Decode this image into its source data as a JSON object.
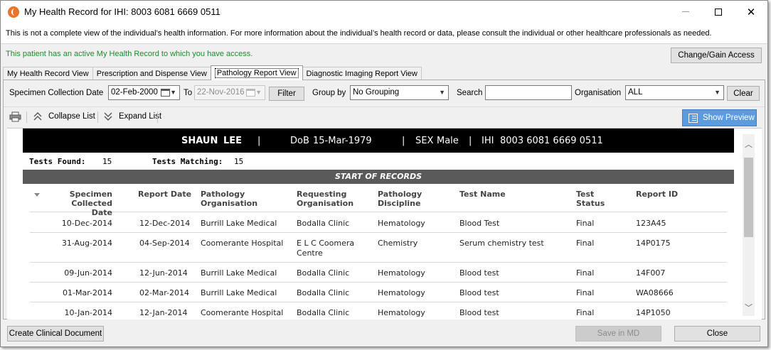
{
  "window": {
    "title": "My Health Record for IHI: 8003 6081 6669 0511",
    "minimize": "—",
    "maximize": "",
    "close": "✕"
  },
  "notice": "This is not a complete view of the individual’s health information. For more information about the individual’s health record or data, please consult the individual or other healthcare professionals as needed.",
  "access": {
    "text": "This patient has an active My Health Record to which you have access.",
    "button": "Change/Gain Access",
    "text_color": "#1e8a2e"
  },
  "tabs": [
    {
      "label": "My Health Record View",
      "active": false
    },
    {
      "label": "Prescription and Dispense View",
      "active": false
    },
    {
      "label": "Pathology Report View",
      "active": true
    },
    {
      "label": "Diagnostic Imaging Report View",
      "active": false
    }
  ],
  "filters": {
    "specimen_label": "Specimen Collection Date",
    "from_date": "02-Feb-2000",
    "to_label": "To",
    "to_date": "22-Nov-2016",
    "filter_button": "Filter",
    "group_label": "Group by",
    "group_value": "No Grouping",
    "search_label": "Search",
    "search_value": "",
    "organisation_label": "Organisation",
    "organisation_value": "ALL",
    "clear_button": "Clear"
  },
  "toolbar": {
    "print_icon": "printer-icon",
    "collapse": "Collapse List",
    "expand": "Expand List",
    "show_preview": "Show Preview",
    "accent": "#5b9ce0"
  },
  "patient": {
    "first_name": "SHAUN",
    "last_name": "LEE",
    "sep": "|",
    "dob_label": "DoB",
    "dob": "15-Mar-1979",
    "sex_label": "SEX",
    "sex": "Male",
    "ihi_label": "IHI",
    "ihi": "8003 6081 6669 0511"
  },
  "counts": {
    "found_label": "Tests Found:",
    "found": "15",
    "matching_label": "Tests Matching:",
    "matching": "15"
  },
  "start_label": "START OF RECORDS",
  "columns": {
    "collected_1": "Specimen",
    "collected_2": "Collected Date",
    "report_date": "Report Date",
    "path_org_1": "Pathology",
    "path_org_2": "Organisation",
    "req_org_1": "Requesting",
    "req_org_2": "Organisation",
    "discipline_1": "Pathology",
    "discipline_2": "Discipline",
    "test_name": "Test Name",
    "status_1": "Test",
    "status_2": "Status",
    "report_id": "Report ID"
  },
  "rows": [
    {
      "collected": "10-Dec-2014",
      "report_date": "12-Dec-2014",
      "path_org": "Burrill Lake Medical",
      "req_org_1": "Bodalla Clinic",
      "req_org_2": "",
      "discipline": "Hematology",
      "test": "Blood Test",
      "status": "Final",
      "report_id": "123A45"
    },
    {
      "collected": "31-Aug-2014",
      "report_date": "04-Sep-2014",
      "path_org": "Coomerante Hospital",
      "req_org_1": "E L C Coomera",
      "req_org_2": "Centre",
      "discipline": "Chemistry",
      "test": "Serum chemistry test",
      "status": "Final",
      "report_id": "14P0175"
    },
    {
      "collected": "09-Jun-2014",
      "report_date": "12-Jun-2014",
      "path_org": "Burrill Lake Medical",
      "req_org_1": "Bodalla Clinic",
      "req_org_2": "",
      "discipline": "Hematology",
      "test": "Blood test",
      "status": "Final",
      "report_id": "14F007"
    },
    {
      "collected": "01-Mar-2014",
      "report_date": "02-Mar-2014",
      "path_org": "Burrill Lake Medical",
      "req_org_1": "Bodalla Clinic",
      "req_org_2": "",
      "discipline": "Hematology",
      "test": "Blood test",
      "status": "Final",
      "report_id": "WA08666"
    },
    {
      "collected": "10-Jan-2014",
      "report_date": "12-Jan-2014",
      "path_org": "Coomerante Hospital",
      "req_org_1": "Bodalla Clinic",
      "req_org_2": "",
      "discipline": "Hematology",
      "test": "Blood test",
      "status": "Final",
      "report_id": "14P1050"
    }
  ],
  "footer": {
    "create_doc": "Create Clinical Document",
    "save": "Save in MD",
    "close": "Close"
  }
}
